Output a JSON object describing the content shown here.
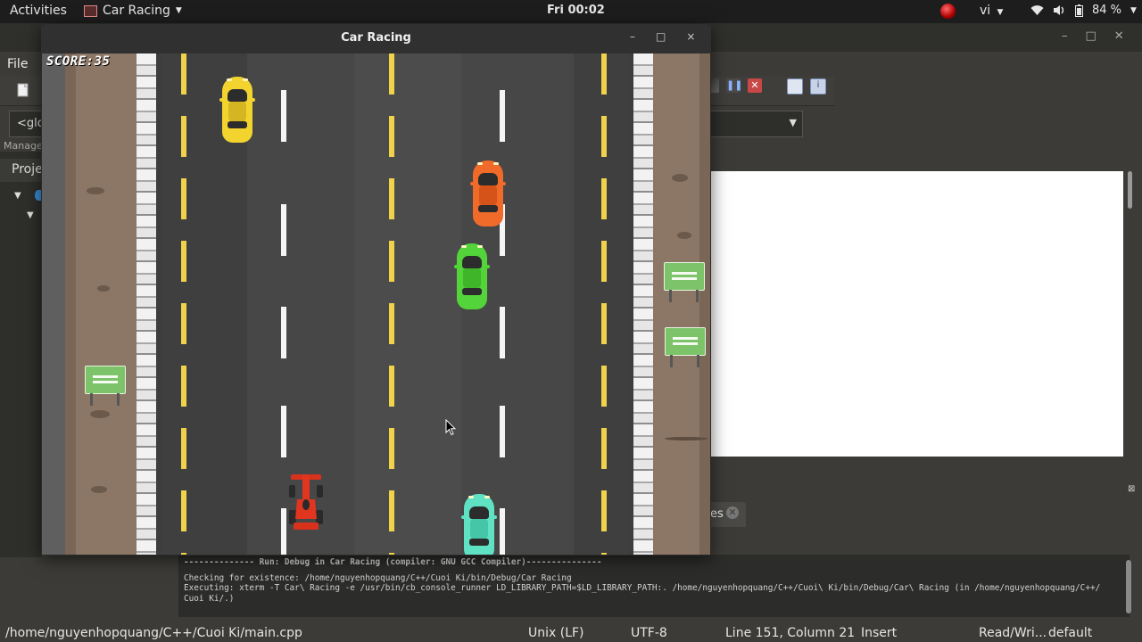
{
  "topbar": {
    "activities": "Activities",
    "app_name": "Car Racing",
    "clock": "Fri 00:02",
    "language": "vi",
    "battery": "84 %"
  },
  "ide": {
    "menu": {
      "file": "File"
    },
    "scope_combo": "<glo",
    "manager_label": "Manage",
    "projects_tab": "Proje",
    "logs_tab_label": "es",
    "build_log": [
      "-------------- Run: Debug in Car Racing (compiler: GNU GCC Compiler)---------------",
      "Checking for existence: /home/nguyenhopquang/C++/Cuoi Ki/bin/Debug/Car Racing",
      "Executing: xterm -T Car\\ Racing -e /usr/bin/cb_console_runner LD_LIBRARY_PATH=$LD_LIBRARY_PATH:. /home/nguyenhopquang/C++/Cuoi\\ Ki/bin/Debug/Car\\ Racing  (in /home/nguyenhopquang/C++/",
      "Cuoi Ki/.)"
    ],
    "status": {
      "path": "/home/nguyenhopquang/C++/Cuoi Ki/main.cpp",
      "eol": "Unix (LF)",
      "encoding": "UTF-8",
      "position": "Line 151, Column 21",
      "mode": "Insert",
      "access": "Read/Wri...",
      "profile": "default"
    }
  },
  "game_window": {
    "title": "Car Racing",
    "buttons": {
      "minimize": "–",
      "maximize": "□",
      "close": "×"
    },
    "score_text": "SCORE:35"
  },
  "game": {
    "score": 35,
    "player_car": {
      "type": "formula",
      "color": "#e0351f"
    },
    "traffic": [
      {
        "id": "yellow",
        "color": "#f3d42f",
        "accent": "#c9a81a"
      },
      {
        "id": "orange",
        "color": "#f06a2a",
        "accent": "#c24c14"
      },
      {
        "id": "green",
        "color": "#52d43a",
        "accent": "#38a526"
      },
      {
        "id": "teal",
        "color": "#5fe2c3",
        "accent": "#36b79a"
      }
    ],
    "colors": {
      "asphalt": "#4c4c4c",
      "lane_yellow": "#f1d24b",
      "lane_white": "#f5f5f5",
      "verge": "#8c7665",
      "sign_green": "#7cc36a"
    }
  }
}
